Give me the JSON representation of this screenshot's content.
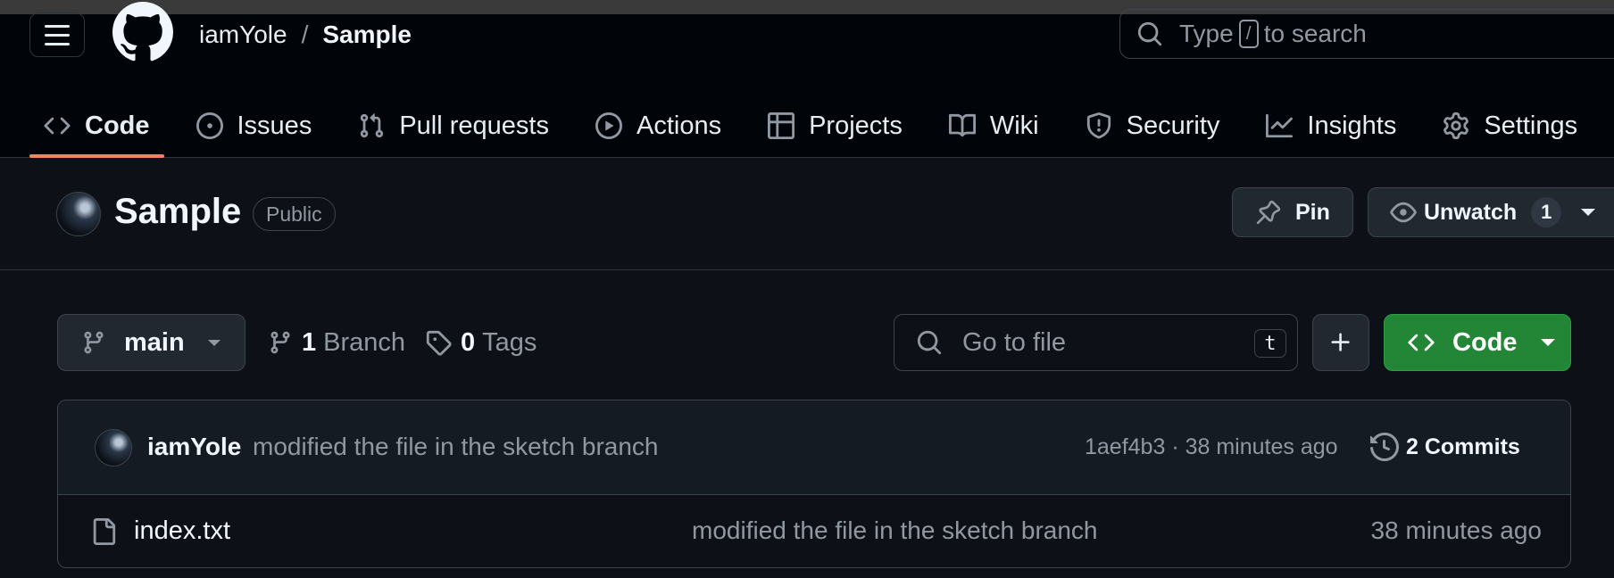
{
  "header": {
    "owner": "iamYole",
    "separator": "/",
    "repo": "Sample",
    "search_prefix": "Type",
    "search_key": "/",
    "search_suffix": "to search"
  },
  "tabs": [
    {
      "label": "Code",
      "icon": "code-icon",
      "active": true
    },
    {
      "label": "Issues",
      "icon": "issue-opened-icon"
    },
    {
      "label": "Pull requests",
      "icon": "git-pull-request-icon"
    },
    {
      "label": "Actions",
      "icon": "play-icon"
    },
    {
      "label": "Projects",
      "icon": "table-icon"
    },
    {
      "label": "Wiki",
      "icon": "book-icon"
    },
    {
      "label": "Security",
      "icon": "shield-icon"
    },
    {
      "label": "Insights",
      "icon": "graph-icon"
    },
    {
      "label": "Settings",
      "icon": "gear-icon"
    }
  ],
  "repo_header": {
    "name": "Sample",
    "visibility": "Public",
    "pin_label": "Pin",
    "unwatch_label": "Unwatch",
    "watch_count": "1"
  },
  "controls": {
    "branch": "main",
    "branch_count": "1",
    "branch_label": "Branch",
    "tag_count": "0",
    "tag_label": "Tags",
    "goto_placeholder": "Go to file",
    "goto_key": "t",
    "code_label": "Code"
  },
  "latest_commit": {
    "author": "iamYole",
    "message": "modified the file in the sketch branch",
    "meta": "1aef4b3 · 38 minutes ago",
    "commits_label": "2 Commits"
  },
  "files": [
    {
      "name": "index.txt",
      "message": "modified the file in the sketch branch",
      "time": "38 minutes ago"
    }
  ],
  "colors": {
    "background": "#0d1117",
    "header_bg": "#010409",
    "accent_underline": "#f78166",
    "primary_button": "#238636",
    "muted_text": "#9198a1",
    "border": "#3d444d"
  }
}
